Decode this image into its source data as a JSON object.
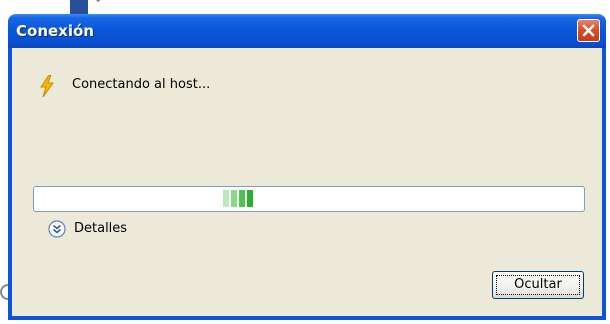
{
  "dialog": {
    "title": "Conexión",
    "status_text": "Conectando al host...",
    "progress_mode": "indeterminate",
    "details_label": "Detalles",
    "hide_button_label": "Ocultar"
  },
  "icons": {
    "status": "lightning-bolt-icon",
    "details_toggle": "chevron-down-circle-icon",
    "close": "close-icon"
  },
  "colors": {
    "titlebar": "#0a55d8",
    "client_background": "#ece9d8",
    "close_button": "#d7502d",
    "progress_fill": "#3fbf3f"
  }
}
